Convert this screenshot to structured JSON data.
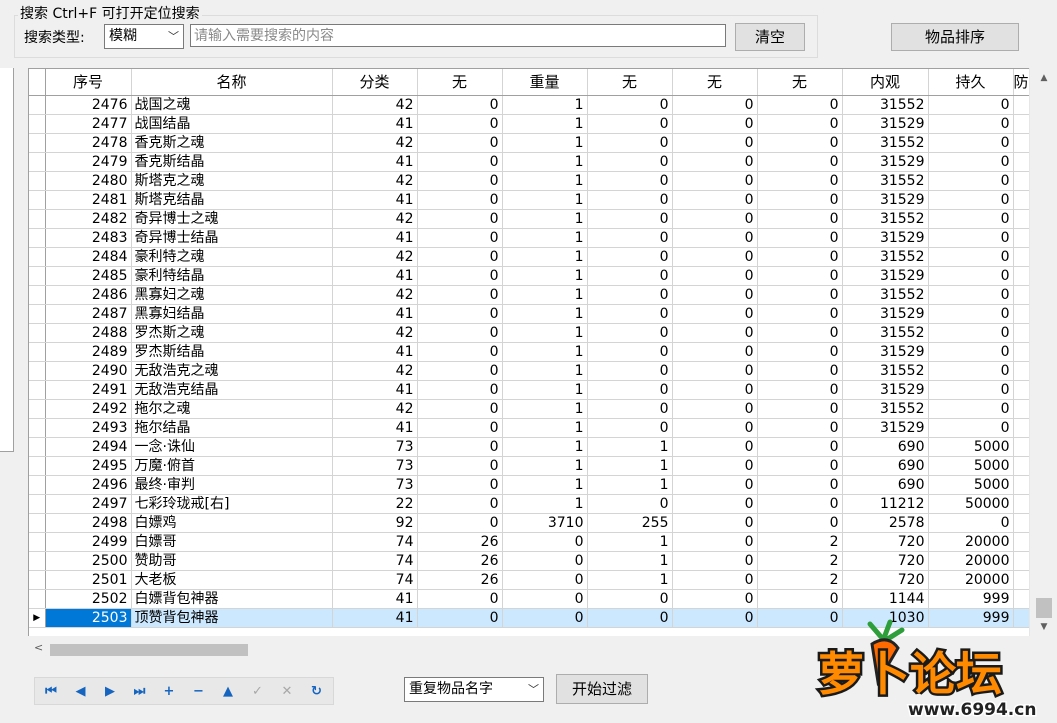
{
  "search": {
    "legend": "搜索  Ctrl+F 可打开定位搜索",
    "type_label": "搜索类型:",
    "type_value": "模糊",
    "placeholder": "请输入需要搜索的内容",
    "clear_label": "清空"
  },
  "sort_label": "物品排序",
  "grid": {
    "columns": [
      "序号",
      "名称",
      "分类",
      "无",
      "重量",
      "无",
      "无",
      "无",
      "内观",
      "持久",
      "防"
    ],
    "rows": [
      [
        "2476",
        "战国之魂",
        "42",
        "0",
        "1",
        "0",
        "0",
        "0",
        "31552",
        "0"
      ],
      [
        "2477",
        "战国结晶",
        "41",
        "0",
        "1",
        "0",
        "0",
        "0",
        "31529",
        "0"
      ],
      [
        "2478",
        "香克斯之魂",
        "42",
        "0",
        "1",
        "0",
        "0",
        "0",
        "31552",
        "0"
      ],
      [
        "2479",
        "香克斯结晶",
        "41",
        "0",
        "1",
        "0",
        "0",
        "0",
        "31529",
        "0"
      ],
      [
        "2480",
        "斯塔克之魂",
        "42",
        "0",
        "1",
        "0",
        "0",
        "0",
        "31552",
        "0"
      ],
      [
        "2481",
        "斯塔克结晶",
        "41",
        "0",
        "1",
        "0",
        "0",
        "0",
        "31529",
        "0"
      ],
      [
        "2482",
        "奇异博士之魂",
        "42",
        "0",
        "1",
        "0",
        "0",
        "0",
        "31552",
        "0"
      ],
      [
        "2483",
        "奇异博士结晶",
        "41",
        "0",
        "1",
        "0",
        "0",
        "0",
        "31529",
        "0"
      ],
      [
        "2484",
        "豪利特之魂",
        "42",
        "0",
        "1",
        "0",
        "0",
        "0",
        "31552",
        "0"
      ],
      [
        "2485",
        "豪利特结晶",
        "41",
        "0",
        "1",
        "0",
        "0",
        "0",
        "31529",
        "0"
      ],
      [
        "2486",
        "黑寡妇之魂",
        "42",
        "0",
        "1",
        "0",
        "0",
        "0",
        "31552",
        "0"
      ],
      [
        "2487",
        "黑寡妇结晶",
        "41",
        "0",
        "1",
        "0",
        "0",
        "0",
        "31529",
        "0"
      ],
      [
        "2488",
        "罗杰斯之魂",
        "42",
        "0",
        "1",
        "0",
        "0",
        "0",
        "31552",
        "0"
      ],
      [
        "2489",
        "罗杰斯结晶",
        "41",
        "0",
        "1",
        "0",
        "0",
        "0",
        "31529",
        "0"
      ],
      [
        "2490",
        "无敌浩克之魂",
        "42",
        "0",
        "1",
        "0",
        "0",
        "0",
        "31552",
        "0"
      ],
      [
        "2491",
        "无敌浩克结晶",
        "41",
        "0",
        "1",
        "0",
        "0",
        "0",
        "31529",
        "0"
      ],
      [
        "2492",
        "拖尔之魂",
        "42",
        "0",
        "1",
        "0",
        "0",
        "0",
        "31552",
        "0"
      ],
      [
        "2493",
        "拖尔结晶",
        "41",
        "0",
        "1",
        "0",
        "0",
        "0",
        "31529",
        "0"
      ],
      [
        "2494",
        "一念·诛仙",
        "73",
        "0",
        "1",
        "1",
        "0",
        "0",
        "690",
        "5000"
      ],
      [
        "2495",
        "万魔·俯首",
        "73",
        "0",
        "1",
        "1",
        "0",
        "0",
        "690",
        "5000"
      ],
      [
        "2496",
        "最终·审判",
        "73",
        "0",
        "1",
        "1",
        "0",
        "0",
        "690",
        "5000"
      ],
      [
        "2497",
        "七彩玲珑戒[右]",
        "22",
        "0",
        "1",
        "0",
        "0",
        "0",
        "11212",
        "50000"
      ],
      [
        "2498",
        "白嫖鸡",
        "92",
        "0",
        "3710",
        "255",
        "0",
        "0",
        "2578",
        "0"
      ],
      [
        "2499",
        "白嫖哥",
        "74",
        "26",
        "0",
        "1",
        "0",
        "2",
        "720",
        "20000"
      ],
      [
        "2500",
        "赞助哥",
        "74",
        "26",
        "0",
        "1",
        "0",
        "2",
        "720",
        "20000"
      ],
      [
        "2501",
        "大老板",
        "74",
        "26",
        "0",
        "1",
        "0",
        "2",
        "720",
        "20000"
      ],
      [
        "2502",
        "白嫖背包神器",
        "41",
        "0",
        "0",
        "0",
        "0",
        "0",
        "1144",
        "999"
      ],
      [
        "2503",
        "顶赞背包神器",
        "41",
        "0",
        "0",
        "0",
        "0",
        "0",
        "1030",
        "999"
      ]
    ],
    "selected_row": 27
  },
  "navigator": {
    "buttons": [
      {
        "name": "first-record-icon",
        "glyph": "⏮",
        "enabled": true
      },
      {
        "name": "prior-record-icon",
        "glyph": "◀",
        "enabled": true
      },
      {
        "name": "next-record-icon",
        "glyph": "▶",
        "enabled": true
      },
      {
        "name": "last-record-icon",
        "glyph": "⏭",
        "enabled": true
      },
      {
        "name": "insert-record-icon",
        "glyph": "+",
        "enabled": true
      },
      {
        "name": "delete-record-icon",
        "glyph": "−",
        "enabled": true
      },
      {
        "name": "edit-record-icon",
        "glyph": "▲",
        "enabled": true
      },
      {
        "name": "post-record-icon",
        "glyph": "✓",
        "enabled": false
      },
      {
        "name": "cancel-record-icon",
        "glyph": "✕",
        "enabled": false
      },
      {
        "name": "refresh-records-icon",
        "glyph": "↻",
        "enabled": true
      }
    ]
  },
  "filter": {
    "mode_value": "重复物品名字",
    "start_label": "开始过滤"
  },
  "watermark": {
    "brand": "萝卜论坛",
    "url": "www.6994.cn"
  }
}
